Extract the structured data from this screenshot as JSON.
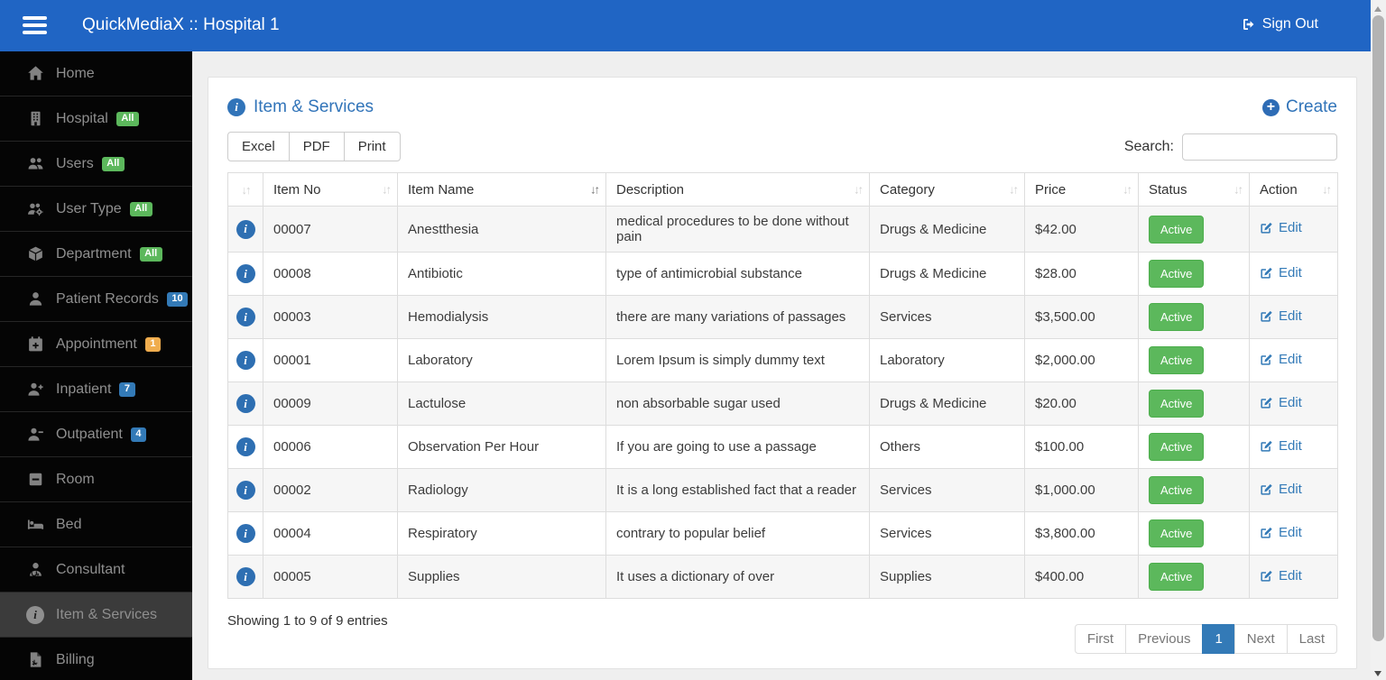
{
  "navbar": {
    "title": "QuickMediaX :: Hospital 1",
    "sign_out": "Sign Out"
  },
  "sidebar": {
    "items": [
      {
        "label": "Home",
        "icon": "home-icon",
        "badge": null,
        "active": false
      },
      {
        "label": "Hospital",
        "icon": "hospital-icon",
        "badge": {
          "text": "All",
          "color": "#5cb85c"
        },
        "active": false
      },
      {
        "label": "Users",
        "icon": "users-icon",
        "badge": {
          "text": "All",
          "color": "#5cb85c"
        },
        "active": false
      },
      {
        "label": "User Type",
        "icon": "user-type-icon",
        "badge": {
          "text": "All",
          "color": "#5cb85c"
        },
        "active": false
      },
      {
        "label": "Department",
        "icon": "department-icon",
        "badge": {
          "text": "All",
          "color": "#5cb85c"
        },
        "active": false
      },
      {
        "label": "Patient Records",
        "icon": "patient-records-icon",
        "badge": {
          "text": "10",
          "color": "#337ab7"
        },
        "active": false
      },
      {
        "label": "Appointment",
        "icon": "appointment-icon",
        "badge": {
          "text": "1",
          "color": "#f0ad4e"
        },
        "active": false
      },
      {
        "label": "Inpatient",
        "icon": "inpatient-icon",
        "badge": {
          "text": "7",
          "color": "#337ab7"
        },
        "active": false
      },
      {
        "label": "Outpatient",
        "icon": "outpatient-icon",
        "badge": {
          "text": "4",
          "color": "#337ab7"
        },
        "active": false
      },
      {
        "label": "Room",
        "icon": "room-icon",
        "badge": null,
        "active": false
      },
      {
        "label": "Bed",
        "icon": "bed-icon",
        "badge": null,
        "active": false
      },
      {
        "label": "Consultant",
        "icon": "consultant-icon",
        "badge": null,
        "active": false
      },
      {
        "label": "Item & Services",
        "icon": "info-circle-icon",
        "badge": null,
        "active": true
      },
      {
        "label": "Billing",
        "icon": "billing-icon",
        "badge": null,
        "active": false
      }
    ]
  },
  "main": {
    "page_title": "Item & Services",
    "create_label": "Create",
    "export_buttons": [
      "Excel",
      "PDF",
      "Print"
    ],
    "search_label": "Search:",
    "search_value": "",
    "table": {
      "columns": [
        "",
        "Item No",
        "Item Name",
        "Description",
        "Category",
        "Price",
        "Status",
        "Action"
      ],
      "sorted_column": "Item Name",
      "rows": [
        {
          "item_no": "00007",
          "item_name": "Anestthesia",
          "description": "medical procedures to be done without pain",
          "category": "Drugs & Medicine",
          "price": "$42.00",
          "status": "Active",
          "action": "Edit"
        },
        {
          "item_no": "00008",
          "item_name": "Antibiotic",
          "description": "type of antimicrobial substance",
          "category": "Drugs & Medicine",
          "price": "$28.00",
          "status": "Active",
          "action": "Edit"
        },
        {
          "item_no": "00003",
          "item_name": "Hemodialysis",
          "description": "there are many variations of passages",
          "category": "Services",
          "price": "$3,500.00",
          "status": "Active",
          "action": "Edit"
        },
        {
          "item_no": "00001",
          "item_name": "Laboratory",
          "description": "Lorem Ipsum is simply dummy text",
          "category": "Laboratory",
          "price": "$2,000.00",
          "status": "Active",
          "action": "Edit"
        },
        {
          "item_no": "00009",
          "item_name": "Lactulose",
          "description": "non absorbable sugar used",
          "category": "Drugs & Medicine",
          "price": "$20.00",
          "status": "Active",
          "action": "Edit"
        },
        {
          "item_no": "00006",
          "item_name": "Observation Per Hour",
          "description": "If you are going to use a passage",
          "category": "Others",
          "price": "$100.00",
          "status": "Active",
          "action": "Edit"
        },
        {
          "item_no": "00002",
          "item_name": "Radiology",
          "description": "It is a long established fact that a reader",
          "category": "Services",
          "price": "$1,000.00",
          "status": "Active",
          "action": "Edit"
        },
        {
          "item_no": "00004",
          "item_name": "Respiratory",
          "description": "contrary to popular belief",
          "category": "Services",
          "price": "$3,800.00",
          "status": "Active",
          "action": "Edit"
        },
        {
          "item_no": "00005",
          "item_name": "Supplies",
          "description": "It uses a dictionary of over",
          "category": "Supplies",
          "price": "$400.00",
          "status": "Active",
          "action": "Edit"
        }
      ]
    },
    "footer": {
      "showing": "Showing 1 to 9 of 9 entries"
    },
    "pagination": {
      "items": [
        "First",
        "Previous",
        "1",
        "Next",
        "Last"
      ],
      "active": "1"
    }
  },
  "colors": {
    "navbar_blue": "#2065c4",
    "link_blue": "#3174b9",
    "edit_blue": "#337ab7",
    "status_green": "#5cb85c",
    "badge_green": "#5cb85c",
    "badge_blue": "#337ab7",
    "badge_orange": "#f0ad4e",
    "sidebar_bg": "#050505",
    "sidebar_active_bg": "#3b3b3b"
  }
}
